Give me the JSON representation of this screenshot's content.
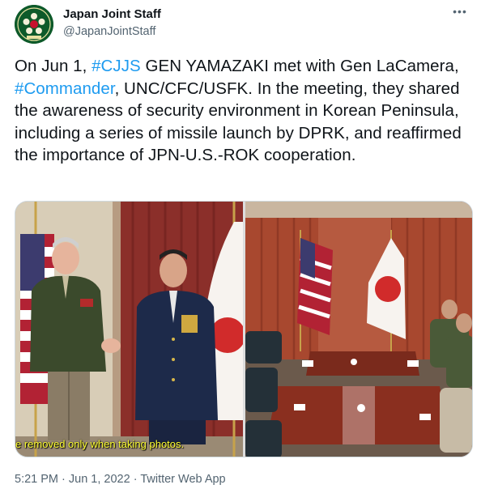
{
  "tweet": {
    "author": {
      "display_name": "Japan Joint Staff",
      "handle": "@JapanJointStaff",
      "avatar_icon": "jsdf-emblem-icon",
      "avatar_color": "#0e5a2a"
    },
    "more_icon": "more-options-icon",
    "text_parts": {
      "p1": "On Jun 1, ",
      "hashtag1": "#CJJS",
      "p2": " GEN YAMAZAKI met with Gen LaCamera, ",
      "hashtag2": "#Commander",
      "p3": ", UNC/CFC/USFK. In the meeting, they shared the awareness of security environment in Korean Peninsula, including a series of missile launch by DPRK, and reaffirmed the importance of JPN-U.S.-ROK cooperation."
    },
    "media": {
      "photo_left_caption": "e removed only when taking photos."
    },
    "meta": {
      "time": "5:21 PM",
      "separator": " · ",
      "date": "Jun 1, 2022",
      "source": "Twitter Web App"
    },
    "colors": {
      "hashtag": "#1d9bf0",
      "secondary_text": "#536471",
      "caption": "#ffff33"
    }
  }
}
